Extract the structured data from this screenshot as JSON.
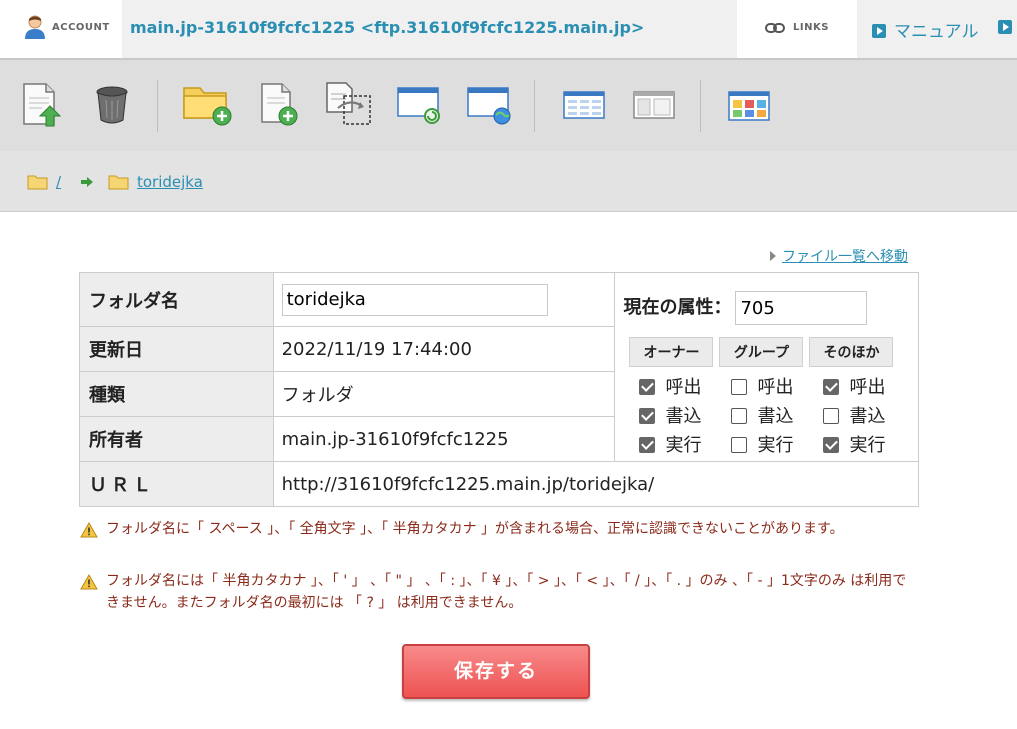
{
  "header": {
    "account_label": "ACCOUNT",
    "server_title": "main.jp-31610f9fcfc1225 <ftp.31610f9fcfc1225.main.jp>",
    "links_label": "LINKS",
    "manual_label": "マニュアル",
    "accent": "#2a8fb2"
  },
  "toolbar": {
    "icons": [
      "upload-file-icon",
      "trash-icon",
      "new-folder-icon",
      "new-file-icon",
      "copy-icon",
      "refresh-window-icon",
      "web-window-icon",
      "list-view-icon",
      "detail-view-icon",
      "thumbnail-view-icon"
    ]
  },
  "breadcrumb": {
    "root": "/",
    "current": "toridejka"
  },
  "main": {
    "back_link": "ファイル一覧へ移動",
    "rows": {
      "folder_name": {
        "label": "フォルダ名",
        "value": "toridejka"
      },
      "updated": {
        "label": "更新日",
        "value": "2022/11/19 17:44:00"
      },
      "type": {
        "label": "種類",
        "value": "フォルダ"
      },
      "owner": {
        "label": "所有者",
        "value": "main.jp-31610f9fcfc1225"
      },
      "url": {
        "label": "ＵＲＬ",
        "value": "http://31610f9fcfc1225.main.jp/toridejka/"
      }
    },
    "attributes": {
      "label": "現在の属性：",
      "value": "705",
      "groups": [
        "オーナー",
        "グループ",
        "そのほか"
      ],
      "perm_labels": [
        "呼出",
        "書込",
        "実行"
      ],
      "checked": [
        [
          true,
          false,
          true
        ],
        [
          true,
          false,
          false
        ],
        [
          true,
          false,
          true
        ]
      ]
    },
    "notes": [
      "フォルダ名に「 スペース 」、「 全角文字 」、「 半角カタカナ 」が含まれる場合、正常に認識できないことがあります。",
      "フォルダ名には「 半角カタカナ 」、「 ' 」 、「 \" 」 、「 : 」、「 ¥ 」、「 > 」、「 < 」、「 / 」、「 . 」のみ 、「 - 」1文字のみ は利用できません。またフォルダ名の最初には 「 ? 」 は利用できません。"
    ],
    "save_label": "保存する"
  }
}
